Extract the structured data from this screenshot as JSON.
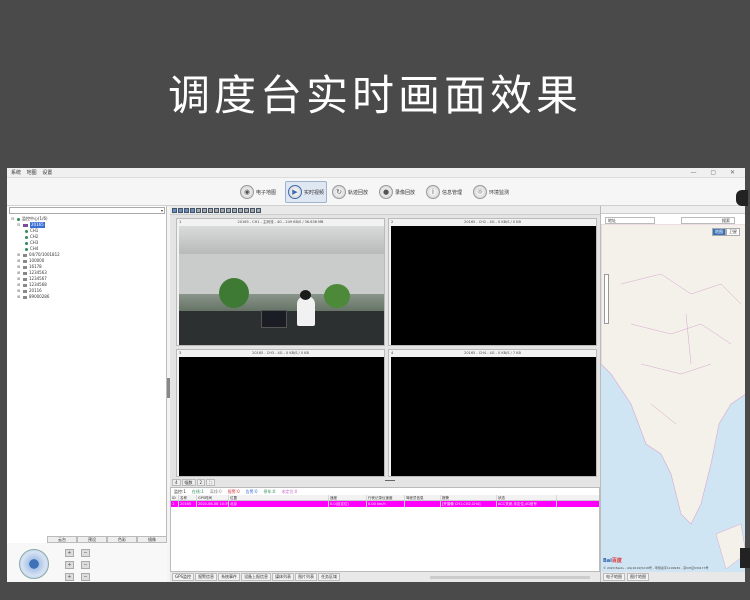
{
  "banner": {
    "title": "调度台实时画面效果"
  },
  "menu": [
    "系统",
    "地图",
    "设置"
  ],
  "toolbar": [
    {
      "label": "电子地图",
      "icon": "map-icon",
      "active": false
    },
    {
      "label": "实时视频",
      "icon": "video-icon",
      "active": true
    },
    {
      "label": "轨迹回放",
      "icon": "track-icon",
      "active": false
    },
    {
      "label": "录像回放",
      "icon": "record-icon",
      "active": false
    },
    {
      "label": "信息管理",
      "icon": "info-icon",
      "active": false
    },
    {
      "label": "环境监测",
      "icon": "env-icon",
      "active": false
    }
  ],
  "tree": {
    "root": "监控中心(1/6)",
    "selected": "20165",
    "channels": [
      "CH1",
      "CH2",
      "CH3",
      "CH4"
    ],
    "devices": [
      "04/70/1001812",
      "100000",
      "16178",
      "1234563",
      "1234567",
      "1234568",
      "20116",
      "89000286"
    ]
  },
  "ptz": {
    "tabs": [
      "云台",
      "预设",
      "色彩",
      "镜像"
    ],
    "preset": "1",
    "buttons": [
      "调用",
      "设置",
      "删除"
    ]
  },
  "videos": [
    {
      "index": "1",
      "header": "20165 - CH1 - 主码流 - 4G - 249 KB/S / 36.636 MB"
    },
    {
      "index": "2",
      "header": "20165 - CH2 - 4G - 0 KB/S / 0 KB"
    },
    {
      "index": "3",
      "header": "20165 - CH3 - 4G - 0 KB/S / 0 KB"
    },
    {
      "index": "4",
      "header": "20165 - CH4 - 4G - 0 KB/S / 7 KB"
    }
  ],
  "center_tabs": [
    "4",
    "幅数",
    "2",
    "⛶"
  ],
  "status_counts": [
    {
      "label": "监控:1",
      "color": "#333333"
    },
    {
      "label": "在线:1",
      "color": "#2e8b57"
    },
    {
      "label": "离线:0",
      "color": "#888888"
    },
    {
      "label": "报警:0",
      "color": "#d33333"
    },
    {
      "label": "告警:0",
      "color": "#3a6fd8"
    },
    {
      "label": "停车:0",
      "color": "#2e8b57"
    },
    {
      "label": "未定位:0",
      "color": "#cc66cc"
    }
  ],
  "table": {
    "columns": [
      "ID",
      "名称",
      "GPS时间",
      "位置",
      "速度",
      "行驶记录仪速度",
      "驾驶员信息",
      "报警",
      "状态"
    ],
    "rows": [
      [
        "1",
        "20165",
        "2020-06-08 10:39:17",
        "北京",
        "0.0(自定位)",
        "0.00 km/h",
        "",
        "[开摄像 CH1,CH2,CH4]",
        "ACC关闭,未定位,4G信号"
      ]
    ]
  },
  "bottom_tabs": [
    "GPS监控",
    "报警信息",
    "系统事件",
    "设备上报信息",
    "媒体列表",
    "图片列表",
    "任务区域"
  ],
  "map": {
    "search_placeholder": "地址",
    "search2_placeholder": "搜索",
    "types": [
      "地图",
      "卫星"
    ],
    "footer_tabs": [
      "电子地图",
      "图片地图"
    ],
    "copyright": "© 2020 Baidu - GS(2019)5218号 - 甲测资字1100930 - 京ICP证030173号",
    "logo": "百度"
  }
}
